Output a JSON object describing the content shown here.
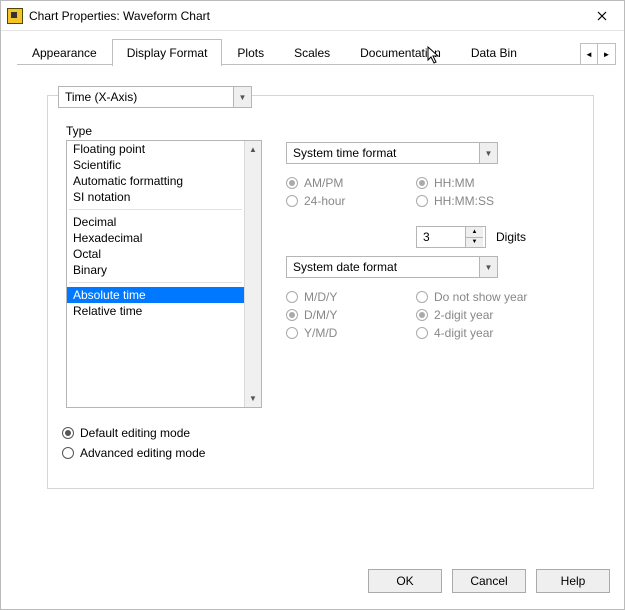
{
  "window": {
    "title": "Chart Properties: Waveform Chart"
  },
  "tabs": {
    "items": [
      "Appearance",
      "Display Format",
      "Plots",
      "Scales",
      "Documentation",
      "Data Bin"
    ],
    "active_index": 1
  },
  "axis_select": {
    "value": "Time (X-Axis)"
  },
  "type": {
    "label": "Type",
    "items_group1": [
      "Floating point",
      "Scientific",
      "Automatic formatting",
      "SI notation"
    ],
    "items_group2": [
      "Decimal",
      "Hexadecimal",
      "Octal",
      "Binary"
    ],
    "items_group3": [
      "Absolute time",
      "Relative time"
    ],
    "selected": "Absolute time"
  },
  "time_format": {
    "select": "System time format",
    "col1": [
      {
        "label": "AM/PM",
        "checked": true
      },
      {
        "label": "24-hour",
        "checked": false
      }
    ],
    "col2": [
      {
        "label": "HH:MM",
        "checked": true
      },
      {
        "label": "HH:MM:SS",
        "checked": false
      }
    ],
    "disabled": true
  },
  "digits": {
    "label": "Digits",
    "value": "3"
  },
  "date_format": {
    "select": "System date format",
    "col1": [
      {
        "label": "M/D/Y",
        "checked": false
      },
      {
        "label": "D/M/Y",
        "checked": true
      },
      {
        "label": "Y/M/D",
        "checked": false
      }
    ],
    "col2": [
      {
        "label": "Do not show year",
        "checked": false
      },
      {
        "label": "2-digit year",
        "checked": true
      },
      {
        "label": "4-digit year",
        "checked": false
      }
    ],
    "disabled": true
  },
  "editing_mode": {
    "default": {
      "label": "Default editing mode",
      "checked": true
    },
    "advanced": {
      "label": "Advanced editing mode",
      "checked": false
    }
  },
  "buttons": {
    "ok": "OK",
    "cancel": "Cancel",
    "help": "Help"
  }
}
